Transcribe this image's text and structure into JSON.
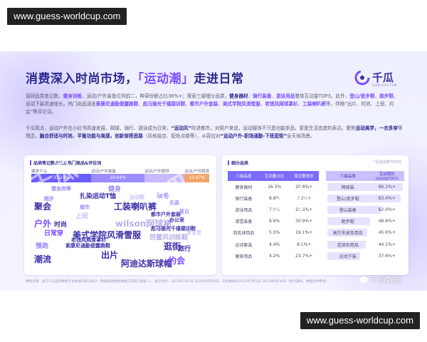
{
  "watermark_top": "www.guess-worldcup.com",
  "watermark_bottom": "www.guess-worldcup.com",
  "headline": {
    "part1": "消费深入时尚市场，",
    "part2": "「运动潮」",
    "part3": "走进日常"
  },
  "brand": {
    "name": "千瓜",
    "sub": "QIAN-GUA.COM"
  },
  "paragraph1": [
    {
      "t": "调研品类笔记数，",
      "s": ""
    },
    {
      "t": "健身训练",
      "s": "kw"
    },
    {
      "t": "、运动/户外装备位列前二，种草份额占比36%+；探索三级细分品类，",
      "s": ""
    },
    {
      "t": "健身器材",
      "s": "kd"
    },
    {
      "t": "、",
      "s": ""
    },
    {
      "t": "骑行装备",
      "s": "kw"
    },
    {
      "t": "、",
      "s": ""
    },
    {
      "t": "游泳用品",
      "s": "kw"
    },
    {
      "t": "整体互动量TOP3。此外，",
      "s": ""
    },
    {
      "t": "登山/徒步鞋",
      "s": "kw"
    },
    {
      "t": "、",
      "s": ""
    },
    {
      "t": "跑步鞋",
      "s": "kw"
    },
    {
      "t": "、运动下装高速增长。热门商品涵盖",
      "s": ""
    },
    {
      "t": "索康尼通勤便露跑鞋",
      "s": "kw"
    },
    {
      "t": "、",
      "s": ""
    },
    {
      "t": "彪马骆光千禧德训鞋",
      "s": "kw"
    },
    {
      "t": "、",
      "s": ""
    },
    {
      "t": "都市户外套装",
      "s": "kw"
    },
    {
      "t": "、",
      "s": ""
    },
    {
      "t": "美式学院风滑雪服",
      "s": "kw"
    },
    {
      "t": "、",
      "s": ""
    },
    {
      "t": "老钱风网球罩衫",
      "s": "kw"
    },
    {
      "t": "、",
      "s": ""
    },
    {
      "t": "工装喇叭裤",
      "s": "kw"
    },
    {
      "t": "等，伴随“出片、时尚、上班、约会”等评论词。",
      "s": ""
    }
  ],
  "paragraph2": [
    {
      "t": "千瓜观点，运动户外在小红书高速发展，网球、骑行、游泳成为日常，",
      "s": ""
    },
    {
      "t": "“运动风”",
      "s": "kd"
    },
    {
      "t": "吹进都市，对用户来说，运动服饰不只是功能单品，更是生活态度的表达。聚焦",
      "s": ""
    },
    {
      "t": "运动美学，一衣多穿",
      "s": "kd"
    },
    {
      "t": "等理念，",
      "s": ""
    },
    {
      "t": "融合舒适与时尚、平衡功能与美感，创新穿搭思路",
      "s": "kd"
    },
    {
      "t": "（风格组合、配色点缀等），从容应对",
      "s": ""
    },
    {
      "t": "“运动户外-职场通勤-下班逛街”",
      "s": "kd"
    },
    {
      "t": "全天候场景。",
      "s": ""
    }
  ],
  "left_panel": {
    "title": "品类笔记数占比及热门商品&评论词",
    "bar_legend": [
      {
        "label": "健身训练"
      },
      {
        "label": "运动/户外装备"
      },
      {
        "label": "运动/户外服饰"
      },
      {
        "label": "运动/户外鞋类"
      }
    ]
  },
  "right_panel": {
    "title": "细分品类",
    "note": "*互动总数TOP25",
    "table1_headers": [
      "三级品类",
      "互动量占比",
      "笔记数增长"
    ],
    "table2_headers": [
      "三级品类"
    ],
    "table2_header_value": "互动增长",
    "table2_header_sub": "(对比同类TOP25)"
  },
  "chart_data": [
    {
      "type": "bar",
      "title": "品类笔记数占比及热门商品&评论词",
      "orientation": "horizontal-stacked",
      "categories": [
        "健身训练",
        "运动/户外装备",
        "运动/户外服饰",
        "运动/户外鞋类"
      ],
      "values": [
        33.24,
        29.64,
        22.26,
        13.67
      ],
      "value_labels": [
        "33.24%",
        "29.64%",
        "",
        "13.67%"
      ],
      "colors": [
        "#6a5cff",
        "#9b8cff",
        "#c7b8ff",
        "#f2a46b"
      ],
      "word_cloud": [
        {
          "text": "健身房等",
          "color": "#9b8cff",
          "weight": 1
        },
        {
          "text": "扎染运动T恤",
          "color": "#3b2fa8",
          "weight": 2
        },
        {
          "text": "聚会",
          "color": "#3b2fa8",
          "weight": 3
        },
        {
          "text": "工装喇叭裤",
          "color": "#3b2fa8",
          "weight": 3
        },
        {
          "text": "wilson网球裙",
          "color": "#b8b0e8",
          "weight": 3
        },
        {
          "text": "户外",
          "color": "#7b4dff",
          "weight": 3
        },
        {
          "text": "上班",
          "color": "#c9c0ff",
          "weight": 2
        },
        {
          "text": "城市",
          "color": "#9b8cff",
          "weight": 1
        },
        {
          "text": "日常穿",
          "color": "#7b4dff",
          "weight": 2
        },
        {
          "text": "美式学院风滑雪服",
          "color": "#3b2fa8",
          "weight": 3
        },
        {
          "text": "慢跑",
          "color": "#9b8cff",
          "weight": 2
        },
        {
          "text": "索康尼通勤便露跑鞋",
          "color": "#3b2fa8",
          "weight": 1
        },
        {
          "text": "潮流",
          "color": "#3b2fa8",
          "weight": 3
        },
        {
          "text": "出片",
          "color": "#3b2fa8",
          "weight": 3
        },
        {
          "text": "阿迪达斯球帽",
          "color": "#3b2fa8",
          "weight": 3
        },
        {
          "text": "逛街",
          "color": "#3b2fa8",
          "weight": 3
        },
        {
          "text": "约会",
          "color": "#7b4dff",
          "weight": 3
        },
        {
          "text": "旅行",
          "color": "#3b2fa8",
          "weight": 2
        },
        {
          "text": "办公室",
          "color": "#3b2fa8",
          "weight": 1
        },
        {
          "text": "彪马骆光千禧德训鞋",
          "color": "#3b2fa8",
          "weight": 1
        },
        {
          "text": "芭蕾风训练鞋",
          "color": "#b8b0e8",
          "weight": 2
        },
        {
          "text": "老钱风网球罩衫",
          "color": "#3b2fa8",
          "weight": 1
        },
        {
          "text": "都市户外套装",
          "color": "#3b2fa8",
          "weight": 1
        },
        {
          "text": "时尚",
          "color": "#3b2fa8",
          "weight": 2
        },
        {
          "text": "秋冬",
          "color": "#9b8cff",
          "weight": 2
        },
        {
          "text": "乐高",
          "color": "#9b8cff",
          "weight": 1
        },
        {
          "text": "运动鞋",
          "color": "#c9c0ff",
          "weight": 1
        },
        {
          "text": "复古",
          "color": "#9b8cff",
          "weight": 1
        },
        {
          "text": "跑步",
          "color": "#9b8cff",
          "weight": 1
        },
        {
          "text": "健身",
          "color": "#9b8cff",
          "weight": 2
        },
        {
          "text": "学生党",
          "color": "#c9c0ff",
          "weight": 1
        }
      ]
    },
    {
      "type": "table",
      "title": "细分品类",
      "columns": [
        "三级品类",
        "互动量占比",
        "笔记数增长"
      ],
      "rows": [
        [
          "健身器材",
          "16.3%",
          "20.8%+"
        ],
        [
          "骑行装备",
          "8.8%",
          "2.3%+"
        ],
        [
          "游泳用品",
          "7.9%",
          "20.5%+"
        ],
        [
          "滑雪装备",
          "6.6%",
          "30.9%+"
        ],
        [
          "羽毛球用品",
          "5.5%",
          "19.1%+"
        ],
        [
          "运动套装",
          "4.4%",
          "8.1%+"
        ],
        [
          "健身用品",
          "4.2%",
          "23.7%+"
        ]
      ]
    },
    {
      "type": "table",
      "title": "互动增长",
      "columns": [
        "三级品类",
        "互动增长"
      ],
      "rows": [
        [
          "网球装",
          "86.1%+"
        ],
        [
          "登山/徒步鞋",
          "83.4%+"
        ],
        [
          "登山装备",
          "62.0%+"
        ],
        [
          "跑步鞋",
          "48.6%+"
        ],
        [
          "高尔夫球及用品",
          "45.6%+"
        ],
        [
          "足球及用品",
          "44.1%+"
        ],
        [
          "运动下装",
          "37.6%+"
        ]
      ],
      "values": [
        86.1,
        83.4,
        62.0,
        48.6,
        45.6,
        44.1,
        37.6
      ]
    }
  ],
  "footnote": "数据说明：基于千瓜品牌数据平台收录的笔记统计（数据来源相关数据已完成口径统一）。统计时间：2023年1月1日-2024年6月30日，同比数据为2022年1月1日-2023年6月30日（统计期间，数据仅供参考）",
  "weibo_label": "千瓜数据"
}
